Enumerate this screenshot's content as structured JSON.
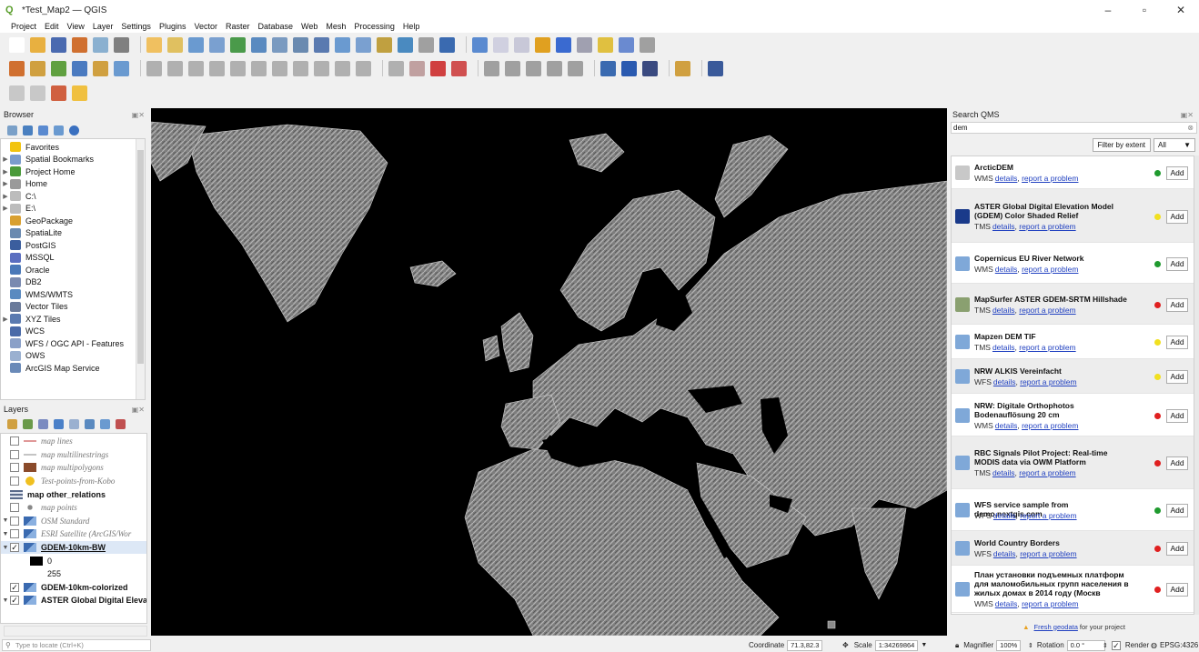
{
  "window": {
    "title": "*Test_Map2 — QGIS",
    "minimize": "–",
    "maximize": "▫",
    "close": "✕"
  },
  "menu": [
    "Project",
    "Edit",
    "View",
    "Layer",
    "Settings",
    "Plugins",
    "Vector",
    "Raster",
    "Database",
    "Web",
    "Mesh",
    "Processing",
    "Help"
  ],
  "browser": {
    "title": "Browser",
    "controls": "▣✕",
    "items": [
      {
        "label": "Favorites",
        "icon": "star-icon",
        "color": "#f2c40f",
        "arrow": ""
      },
      {
        "label": "Spatial Bookmarks",
        "icon": "bookmark-icon",
        "color": "#7a9ccc",
        "arrow": "▶"
      },
      {
        "label": "Project Home",
        "icon": "project-home-icon",
        "color": "#4a9a3a",
        "arrow": "▶"
      },
      {
        "label": "Home",
        "icon": "home-icon",
        "color": "#9a9a9a",
        "arrow": "▶"
      },
      {
        "label": "C:\\",
        "icon": "drive-icon",
        "color": "#bcbcbc",
        "arrow": "▶"
      },
      {
        "label": "E:\\",
        "icon": "drive-icon",
        "color": "#bcbcbc",
        "arrow": "▶"
      },
      {
        "label": "GeoPackage",
        "icon": "geopackage-icon",
        "color": "#d9a030",
        "arrow": ""
      },
      {
        "label": "SpatiaLite",
        "icon": "spatialite-icon",
        "color": "#6a8ab0",
        "arrow": ""
      },
      {
        "label": "PostGIS",
        "icon": "postgis-icon",
        "color": "#3b5e9e",
        "arrow": ""
      },
      {
        "label": "MSSQL",
        "icon": "mssql-icon",
        "color": "#5a6ec0",
        "arrow": ""
      },
      {
        "label": "Oracle",
        "icon": "oracle-icon",
        "color": "#4a78b8",
        "arrow": ""
      },
      {
        "label": "DB2",
        "icon": "db2-icon",
        "color": "#7a8ab0",
        "arrow": ""
      },
      {
        "label": "WMS/WMTS",
        "icon": "wms-icon",
        "color": "#5a8ac0",
        "arrow": ""
      },
      {
        "label": "Vector Tiles",
        "icon": "vector-tiles-icon",
        "color": "#6a7a9a",
        "arrow": ""
      },
      {
        "label": "XYZ Tiles",
        "icon": "xyz-tiles-icon",
        "color": "#5a7ab0",
        "arrow": "▶"
      },
      {
        "label": "WCS",
        "icon": "wcs-icon",
        "color": "#4a6aa8",
        "arrow": ""
      },
      {
        "label": "WFS / OGC API - Features",
        "icon": "wfs-icon",
        "color": "#8aa0c8",
        "arrow": ""
      },
      {
        "label": "OWS",
        "icon": "ows-icon",
        "color": "#9ab0d0",
        "arrow": ""
      },
      {
        "label": "ArcGIS Map Service",
        "icon": "arcgis-icon",
        "color": "#6a8ab8",
        "arrow": ""
      }
    ]
  },
  "layers": {
    "title": "Layers",
    "controls": "▣✕",
    "items": [
      {
        "label": "map lines",
        "style": "italic-grey",
        "arrow": "",
        "checked": "",
        "sym": "line-red"
      },
      {
        "label": "map multilinestrings",
        "style": "italic-grey",
        "arrow": "",
        "checked": "",
        "sym": "line-grey"
      },
      {
        "label": "map multipolygons",
        "style": "italic-grey",
        "arrow": "",
        "checked": "",
        "sym": "fill-brown"
      },
      {
        "label": "Test-points-from-Kobo",
        "style": "italic-grey",
        "arrow": "",
        "checked": "",
        "sym": "circle-yellow"
      },
      {
        "label": "map other_relations",
        "style": "bold",
        "arrow": "",
        "checked": null,
        "sym": "table"
      },
      {
        "label": "map points",
        "style": "italic-grey",
        "arrow": "",
        "checked": "",
        "sym": "point-grey"
      },
      {
        "label": "OSM Standard",
        "style": "italic-grey",
        "arrow": "▼",
        "checked": "",
        "sym": "raster"
      },
      {
        "label": "ESRI Satellite (ArcGIS/Wor",
        "style": "italic-grey",
        "arrow": "▼",
        "checked": "",
        "sym": "raster"
      },
      {
        "label": "GDEM-10km-BW",
        "style": "bold-underline",
        "arrow": "▼",
        "checked": "✓",
        "sym": "raster"
      },
      {
        "label": "0",
        "style": "legend",
        "arrow": "",
        "checked": null,
        "sym": "black-swatch"
      },
      {
        "label": "255",
        "style": "legend",
        "arrow": "",
        "checked": null,
        "sym": "none"
      },
      {
        "label": "GDEM-10km-colorized",
        "style": "bold",
        "arrow": "",
        "checked": "✓",
        "sym": "raster"
      },
      {
        "label": "ASTER Global Digital Elevat",
        "style": "bold",
        "arrow": "▼",
        "checked": "✓",
        "sym": "raster"
      }
    ]
  },
  "qms": {
    "title": "Search QMS",
    "controls": "▣✕",
    "search_value": "dem",
    "clear_icon": "⊗",
    "filter_button": "Filter by extent",
    "filter_select": "All",
    "detail_link": "details",
    "report_link": "report a problem",
    "add_label": "Add",
    "services": [
      {
        "title": "ArcticDEM",
        "type": "WMS",
        "status": "#1f9a2e",
        "icon": "#c8c8c8",
        "h": 36,
        "lines": 1
      },
      {
        "title": "ASTER Global Digital Elevation Model (GDEM) Color Shaded Relief",
        "type": "TMS",
        "status": "#f1e020",
        "icon": "#1a3a8a",
        "h": 59,
        "lines": 2
      },
      {
        "title": "Copernicus EU River Network",
        "type": "WMS",
        "status": "#1f9a2e",
        "icon": "#7fa8d8",
        "h": 45,
        "lines": 1
      },
      {
        "title": "MapSurfer ASTER GDEM-SRTM Hillshade",
        "type": "TMS",
        "status": "#e02020",
        "icon": "#8aa070",
        "h": 45,
        "lines": 1
      },
      {
        "title": "Mapzen DEM TIF",
        "type": "TMS",
        "status": "#f1e020",
        "icon": "#7fa8d8",
        "h": 38,
        "lines": 1
      },
      {
        "title": "NRW ALKIS Vereinfacht",
        "type": "WFS",
        "status": "#f1e020",
        "icon": "#7fa8d8",
        "h": 38,
        "lines": 1
      },
      {
        "title": "NRW: Digitale Orthophotos Bodenauflösung 20 cm",
        "type": "WMS",
        "status": "#e02020",
        "icon": "#7fa8d8",
        "h": 47,
        "lines": 2
      },
      {
        "title": "RBC Signals Pilot Project: Real-time MODIS data via OWM Platform",
        "type": "TMS",
        "status": "#e02020",
        "icon": "#7fa8d8",
        "h": 58,
        "lines": 2
      },
      {
        "title": "WFS service sample from demo.nextgis.com",
        "type": "WFS",
        "status": "#1f9a2e",
        "icon": "#7fa8d8",
        "h": 46,
        "lines": 1
      },
      {
        "title": "World Country Borders",
        "type": "WFS",
        "status": "#e02020",
        "icon": "#7fa8d8",
        "h": 38,
        "lines": 1
      },
      {
        "title": "План установки подъемных платформ для маломобильных групп населения в жилых домах в 2014 году (Москв",
        "type": "WMS",
        "status": "#e02020",
        "icon": "#7fa8d8",
        "h": 52,
        "lines": 3
      }
    ],
    "footer_link": "Fresh geodata",
    "footer_text": "for your project"
  },
  "status": {
    "locator_placeholder": "Type to locate (Ctrl+K)",
    "coordinate_label": "Coordinate",
    "coordinate_value": "71.3,82.3",
    "scale_label": "Scale",
    "scale_value": "1:34269864",
    "magnifier_label": "Magnifier",
    "magnifier_value": "100%",
    "rotation_label": "Rotation",
    "rotation_value": "0.0 °",
    "render_label": "Render",
    "crs_label": "EPSG:4326"
  }
}
